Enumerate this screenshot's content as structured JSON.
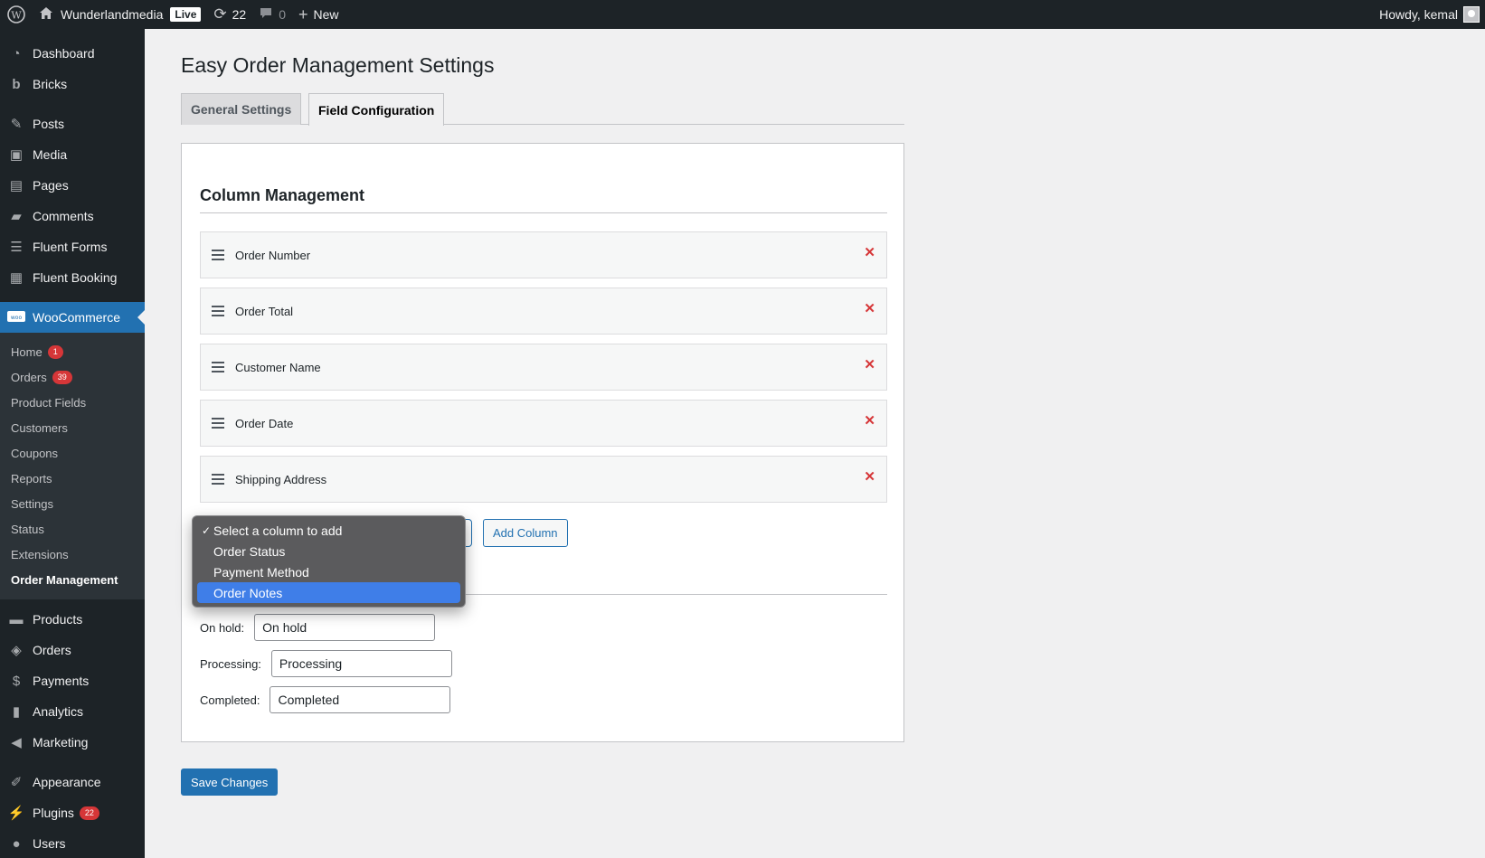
{
  "admin_bar": {
    "site_name": "Wunderlandmedia",
    "live_label": "Live",
    "updates_count": "22",
    "comments_count": "0",
    "new_label": "New",
    "greeting": "Howdy, kemal"
  },
  "sidebar": {
    "items_top": [
      {
        "label": "Dashboard",
        "icon": "dashboard-icon"
      },
      {
        "label": "Bricks",
        "icon": "bricks-icon"
      }
    ],
    "items_mid": [
      {
        "label": "Posts",
        "icon": "pin-icon"
      },
      {
        "label": "Media",
        "icon": "media-icon"
      },
      {
        "label": "Pages",
        "icon": "pages-icon"
      },
      {
        "label": "Comments",
        "icon": "comment-icon"
      },
      {
        "label": "Fluent Forms",
        "icon": "form-icon"
      },
      {
        "label": "Fluent Booking",
        "icon": "booking-icon"
      }
    ],
    "woocommerce": {
      "label": "WooCommerce",
      "submenu": [
        {
          "label": "Home",
          "badge": "1"
        },
        {
          "label": "Orders",
          "badge": "39"
        },
        {
          "label": "Product Fields"
        },
        {
          "label": "Customers"
        },
        {
          "label": "Coupons"
        },
        {
          "label": "Reports"
        },
        {
          "label": "Settings"
        },
        {
          "label": "Status"
        },
        {
          "label": "Extensions"
        },
        {
          "label": "Order Management"
        }
      ]
    },
    "items_bottom": [
      {
        "label": "Products",
        "icon": "archive-icon"
      },
      {
        "label": "Orders",
        "icon": "tag-icon"
      },
      {
        "label": "Payments",
        "icon": "payments-icon"
      },
      {
        "label": "Analytics",
        "icon": "chart-icon"
      },
      {
        "label": "Marketing",
        "icon": "megaphone-icon"
      }
    ],
    "items_last": [
      {
        "label": "Appearance",
        "icon": "brush-icon"
      },
      {
        "label": "Plugins",
        "icon": "plug-icon",
        "badge": "22"
      },
      {
        "label": "Users",
        "icon": "user-icon"
      }
    ]
  },
  "page": {
    "title": "Easy Order Management Settings",
    "tabs": [
      {
        "label": "General Settings"
      },
      {
        "label": "Field Configuration"
      }
    ],
    "section_title": "Column Management",
    "columns": [
      {
        "label": "Order Number"
      },
      {
        "label": "Order Total"
      },
      {
        "label": "Customer Name"
      },
      {
        "label": "Order Date"
      },
      {
        "label": "Shipping Address"
      }
    ],
    "add_column_label": "Add Column",
    "status_fields": [
      {
        "label": "On hold:",
        "value": "On hold"
      },
      {
        "label": "Processing:",
        "value": "Processing"
      },
      {
        "label": "Completed:",
        "value": "Completed"
      }
    ],
    "save_label": "Save Changes"
  },
  "dropdown": {
    "options": [
      {
        "label": "Select a column to add",
        "checked": true
      },
      {
        "label": "Order Status"
      },
      {
        "label": "Payment Method"
      },
      {
        "label": "Order Notes",
        "highlighted": true
      }
    ]
  },
  "colors": {
    "admin_bg": "#1d2327",
    "accent": "#2271b1",
    "danger": "#d63638",
    "highlight": "#3f7ee8"
  }
}
